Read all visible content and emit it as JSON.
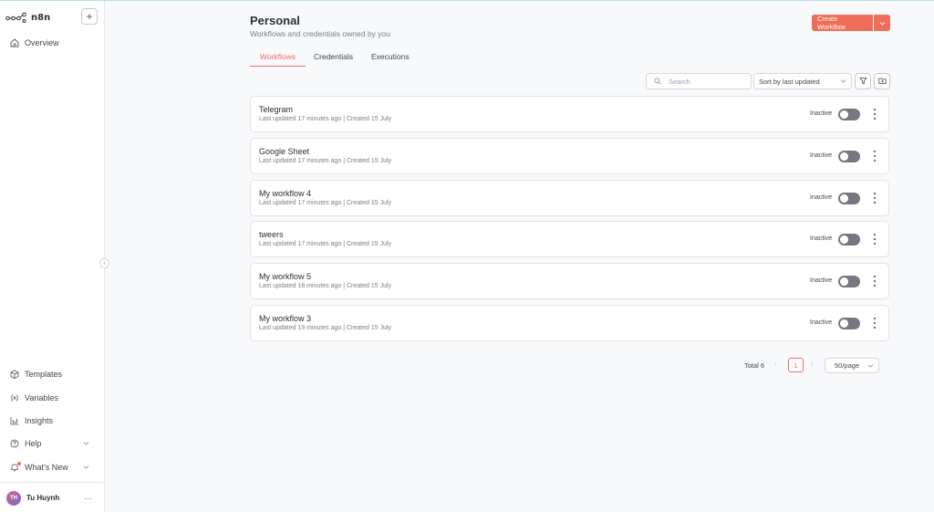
{
  "app": {
    "name": "n8n",
    "add_label": "+"
  },
  "sidebar": {
    "top_items": [
      {
        "label": "Overview",
        "icon": "home-icon"
      }
    ],
    "bottom_items": [
      {
        "label": "Templates",
        "icon": "box-icon"
      },
      {
        "label": "Variables",
        "icon": "variable-icon"
      },
      {
        "label": "Insights",
        "icon": "chart-icon"
      },
      {
        "label": "Help",
        "icon": "help-icon"
      },
      {
        "label": "What's New",
        "icon": "bell-icon"
      }
    ],
    "user": {
      "initials": "TH",
      "name": "Tu Huynh",
      "more": "···"
    }
  },
  "page": {
    "title": "Personal",
    "subtitle": "Workflows and credentials owned by you",
    "create_label": "Create Workflow"
  },
  "tabs": [
    {
      "label": "Workflows",
      "active": true
    },
    {
      "label": "Credentials",
      "active": false
    },
    {
      "label": "Executions",
      "active": false
    }
  ],
  "toolbar": {
    "search_placeholder": "Search",
    "sort_label": "Sort by last updated"
  },
  "workflows": [
    {
      "name": "Telegram",
      "meta": "Last updated 17 minutes ago | Created 15 July",
      "status": "Inactive",
      "active": false
    },
    {
      "name": "Google Sheet",
      "meta": "Last updated 17 minutes ago | Created 15 July",
      "status": "Inactive",
      "active": false
    },
    {
      "name": "My workflow 4",
      "meta": "Last updated 17 minutes ago | Created 15 July",
      "status": "Inactive",
      "active": false
    },
    {
      "name": "tweers",
      "meta": "Last updated 17 minutes ago | Created 15 July",
      "status": "Inactive",
      "active": false
    },
    {
      "name": "My workflow 5",
      "meta": "Last updated 18 minutes ago | Created 15 July",
      "status": "Inactive",
      "active": false
    },
    {
      "name": "My workflow 3",
      "meta": "Last updated 19 minutes ago | Created 15 July",
      "status": "Inactive",
      "active": false
    }
  ],
  "pagination": {
    "total": "Total 6",
    "current_page": "1",
    "per_page": "50/page"
  },
  "colors": {
    "accent": "#ee6e5b",
    "toggle_off": "#77787f"
  }
}
